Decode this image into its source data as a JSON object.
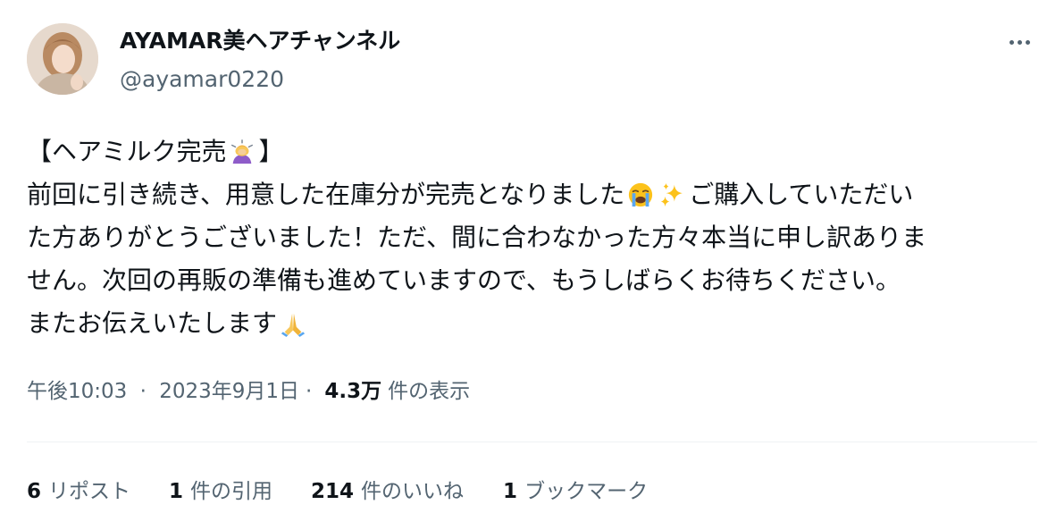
{
  "user": {
    "display_name": "AYAMAR美ヘアチャンネル",
    "handle": "@ayamar0220"
  },
  "tweet": {
    "lines": [
      {
        "segments": [
          {
            "type": "text",
            "value": "【ヘアミルク完売"
          },
          {
            "type": "emoji",
            "icon": "person-bowing-emoji"
          },
          {
            "type": "text",
            "value": "】"
          }
        ]
      },
      {
        "segments": [
          {
            "type": "text",
            "value": "前回に引き続き、用意した在庫分が完売となりました"
          },
          {
            "type": "emoji",
            "icon": "loudly-crying-face-emoji"
          },
          {
            "type": "emoji",
            "icon": "sparkles-emoji"
          },
          {
            "type": "text",
            "value": "ご購入していただい"
          }
        ]
      },
      {
        "segments": [
          {
            "type": "text",
            "value": "た方ありがとうございました！ただ、間に合わなかった方々本当に申し訳ありま"
          }
        ]
      },
      {
        "segments": [
          {
            "type": "text",
            "value": "せん。次回の再販の準備も進めていますので、もうしばらくお待ちください。"
          }
        ]
      },
      {
        "segments": [
          {
            "type": "text",
            "value": "またお伝えいたします"
          },
          {
            "type": "emoji",
            "icon": "folded-hands-emoji"
          }
        ]
      }
    ],
    "time": "午後10:03",
    "date": "2023年9月1日",
    "separator": "·",
    "views_count": "4.3万",
    "views_label": "件の表示"
  },
  "stats": {
    "retweets": {
      "count": "6",
      "label": "リポスト"
    },
    "quotes": {
      "count": "1",
      "label": "件の引用"
    },
    "likes": {
      "count": "214",
      "label": "件のいいね"
    },
    "bookmarks": {
      "count": "1",
      "label": "ブックマーク"
    }
  },
  "colors": {
    "text": "#0f1419",
    "secondary": "#536471",
    "divider": "#eff3f4"
  }
}
